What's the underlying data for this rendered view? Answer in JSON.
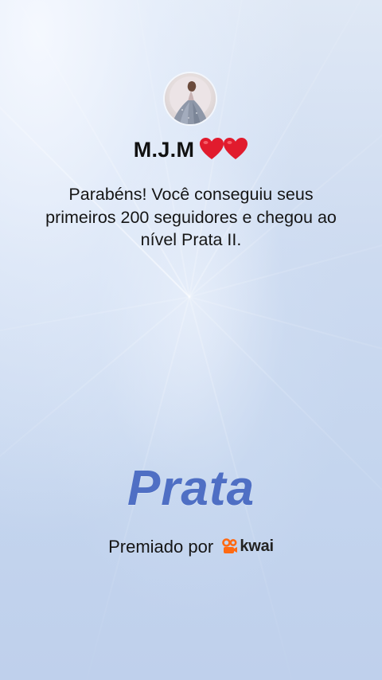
{
  "profile": {
    "name": "M.J.M",
    "heart_icons": [
      "red-heart-icon",
      "red-heart-icon"
    ]
  },
  "message": {
    "text": "Parabéns! Você conseguiu seus primeiros 200 seguidores e chegou ao nível Prata II."
  },
  "level": {
    "title": "Prata",
    "color": "#4f6fc4"
  },
  "footer": {
    "awarded_by_label": "Premiado por",
    "brand_name": "kwai",
    "brand_color": "#ff6a13"
  },
  "colors": {
    "background": "#c8d7ee",
    "heart": "#e11b2d"
  }
}
